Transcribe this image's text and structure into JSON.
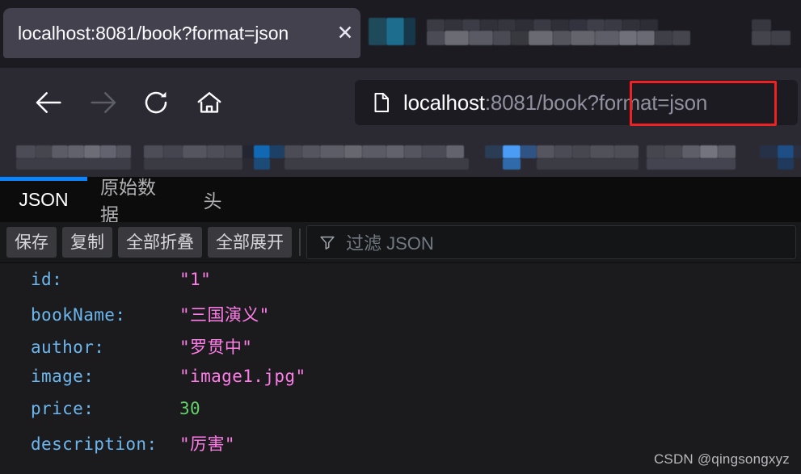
{
  "browser": {
    "tab": {
      "title": "localhost:8081/book?format=json",
      "close_label": "✕"
    },
    "nav": {
      "back_label": "后退",
      "forward_label": "前进",
      "reload_label": "重新载入",
      "home_label": "主页"
    },
    "urlbar": {
      "page_icon": "page-icon",
      "host": "localhost",
      "path": ":8081/book",
      "query": "?format=json",
      "full_url": "localhost:8081/book?format=json"
    },
    "annotation": {
      "color": "#ee2222",
      "target_text": "?format=json"
    }
  },
  "viewer": {
    "tabs": [
      {
        "label": "JSON",
        "active": true
      },
      {
        "label": "原始数据",
        "active": false
      },
      {
        "label": "头",
        "active": false
      }
    ],
    "toolbar": {
      "save_label": "保存",
      "copy_label": "复制",
      "collapse_all_label": "全部折叠",
      "expand_all_label": "全部展开",
      "filter_icon": "filter-icon",
      "filter_placeholder": "过滤 JSON"
    },
    "rows": [
      {
        "key": "id:",
        "value": "\"1\"",
        "type": "string"
      },
      {
        "key": "bookName:",
        "value": "\"三国演义\"",
        "type": "string"
      },
      {
        "key": "author:",
        "value": "\"罗贯中\"",
        "type": "string"
      },
      {
        "key": "image:",
        "value": "\"image1.jpg\"",
        "type": "string"
      },
      {
        "key": "price:",
        "value": "30",
        "type": "number"
      },
      {
        "key": "description:",
        "value": "\"厉害\"",
        "type": "string"
      }
    ]
  },
  "watermark": {
    "text": "CSDN @qingsongxyz"
  },
  "colors": {
    "accent_blue": "#0a84ff",
    "json_key": "#6cb7ef",
    "json_string": "#ff7de9",
    "json_number": "#64d06a",
    "annotation_red": "#ee2222"
  }
}
